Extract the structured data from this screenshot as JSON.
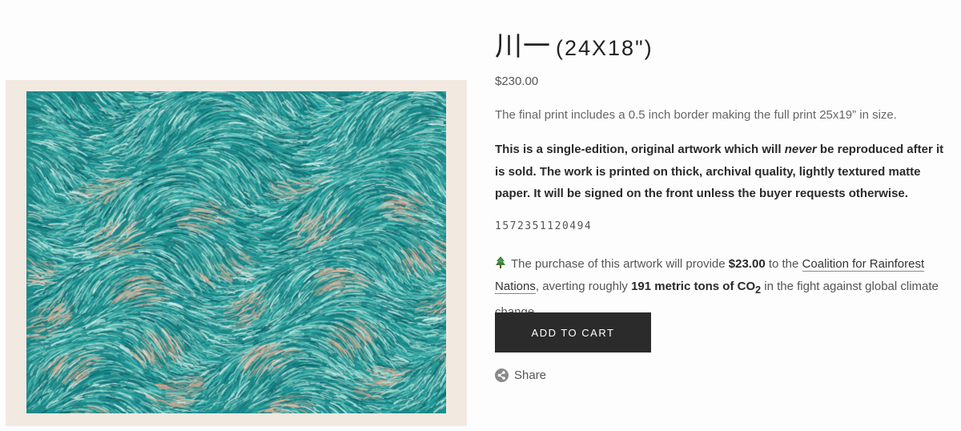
{
  "product": {
    "title_main": "川一",
    "title_size": "(24X18\")",
    "price": "$230.00",
    "description": "The final print includes a 0.5 inch border making the full print 25x19” in size.",
    "edition_part1": "This is a single-edition, original artwork which will ",
    "edition_emphasis": "never",
    "edition_part2": " be reproduced after it is sold. The work is printed on thick, archival quality, lightly textured matte paper. It will be signed on the front unless the buyer requests otherwise.",
    "code": "1572351120494",
    "artwork_alt": "Generative artwork of teal and peach hair-like brush strokes"
  },
  "impact": {
    "icon": "evergreen-tree-icon",
    "text1": "The purchase of this artwork will provide ",
    "amount": "$23.00",
    "text2": " to the ",
    "link_label": "Coalition for Rainforest Nations",
    "text3": ", averting roughly ",
    "tons": "191 metric tons of CO",
    "tons_sub": "2",
    "text4": " in the fight against global climate change."
  },
  "actions": {
    "add_to_cart": "ADD TO CART",
    "share_label": "Share",
    "share_icon": "share-icon"
  },
  "colors": {
    "button_bg": "#2b2b2b",
    "frame_bg": "#f2e9e1",
    "art_teal": "#2a9a98",
    "art_dark_teal": "#0f6f73",
    "art_peach": "#e7b49a"
  }
}
